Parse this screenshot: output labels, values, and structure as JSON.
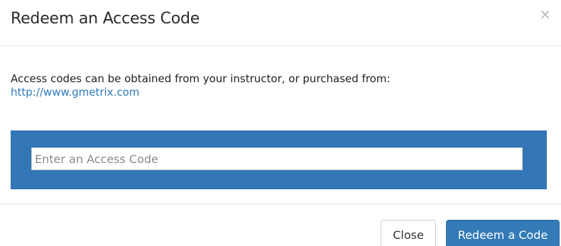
{
  "dialog": {
    "title": "Redeem an Access Code",
    "close_icon_glyph": "×"
  },
  "body": {
    "intro_text": "Access codes can be obtained from your instructor, or purchased from:",
    "link_text": "http://www.gmetrix.com",
    "input_placeholder": "Enter an Access Code",
    "input_value": ""
  },
  "footer": {
    "close_label": "Close",
    "redeem_label": "Redeem a Code"
  },
  "colors": {
    "accent": "#337ab7",
    "panel": "#3376b5",
    "link": "#2f7bbf"
  }
}
